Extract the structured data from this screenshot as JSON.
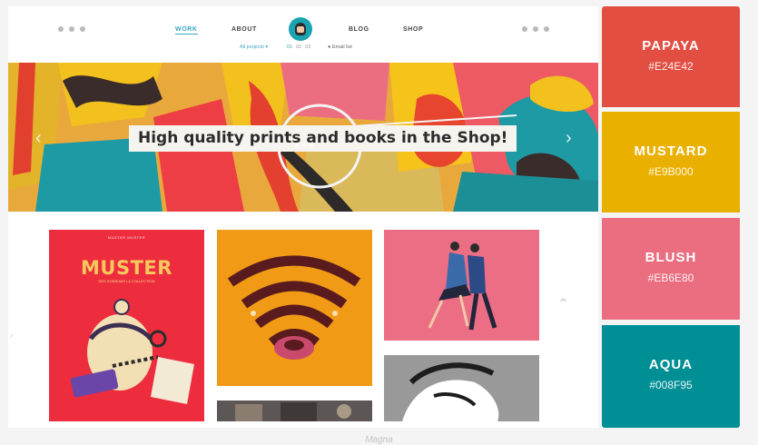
{
  "header": {
    "nav": [
      "WORK",
      "ABOUT",
      "BLOG",
      "SHOP"
    ],
    "subnav": {
      "projects": "All projects ▾",
      "pager": [
        "01",
        "02",
        "03"
      ],
      "email": "● Email list"
    },
    "social_left_icons": [
      "instagram-icon",
      "dribbble-icon",
      "behance-icon"
    ],
    "social_right_icons": [
      "facebook-icon",
      "twitter-icon",
      "vimeo-icon"
    ]
  },
  "hero": {
    "caption": "High quality prints and books in the Shop!",
    "prev_arrow": "‹",
    "next_arrow": "›"
  },
  "grid": {
    "muster_small": "MUSTER MUSTER",
    "muster_title": "MUSTER",
    "muster_sub": "DES KONSUMS LA COLLECTION",
    "up_arrow": "⌃",
    "left_hint": "›"
  },
  "palette": [
    {
      "name": "PAPAYA",
      "hex": "#E24E42",
      "color": "#E24E42"
    },
    {
      "name": "MUSTARD",
      "hex": "#E9B000",
      "color": "#E9B000"
    },
    {
      "name": "BLUSH",
      "hex": "#EB6E80",
      "color": "#EB6E80"
    },
    {
      "name": "AQUA",
      "hex": "#008F95",
      "color": "#008F95"
    }
  ],
  "caption": "Magna"
}
